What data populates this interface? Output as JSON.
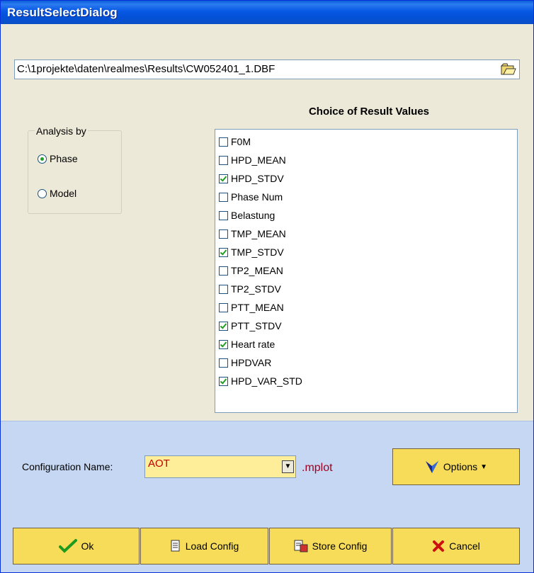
{
  "window": {
    "title": "ResultSelectDialog"
  },
  "file": {
    "path": "C:\\1projekte\\daten\\realmes\\Results\\CW052401_1.DBF",
    "browse_icon": "folder-open-icon"
  },
  "analysis": {
    "group_label": "Analysis by",
    "options": [
      {
        "label": "Phase",
        "selected": true
      },
      {
        "label": "Model",
        "selected": false
      }
    ]
  },
  "results": {
    "title": "Choice of Result Values",
    "items": [
      {
        "label": "F0M",
        "checked": false
      },
      {
        "label": "HPD_MEAN",
        "checked": false
      },
      {
        "label": "HPD_STDV",
        "checked": true
      },
      {
        "label": "Phase Num",
        "checked": false
      },
      {
        "label": "Belastung",
        "checked": false
      },
      {
        "label": "TMP_MEAN",
        "checked": false
      },
      {
        "label": "TMP_STDV",
        "checked": true
      },
      {
        "label": "TP2_MEAN",
        "checked": false
      },
      {
        "label": "TP2_STDV",
        "checked": false
      },
      {
        "label": "PTT_MEAN",
        "checked": false
      },
      {
        "label": "PTT_STDV",
        "checked": true
      },
      {
        "label": "Heart rate",
        "checked": true
      },
      {
        "label": "HPDVAR",
        "checked": false
      },
      {
        "label": "HPD_VAR_STD",
        "checked": true
      }
    ]
  },
  "config": {
    "label": "Configuration Name:",
    "value": "AOT",
    "extension": ".mplot"
  },
  "buttons": {
    "options": "Options",
    "ok": "Ok",
    "load": "Load Config",
    "store": "Store Config",
    "cancel": "Cancel"
  },
  "colors": {
    "button": "#f7dc5a",
    "footer": "#c5d7f2",
    "check": "#21a121"
  }
}
